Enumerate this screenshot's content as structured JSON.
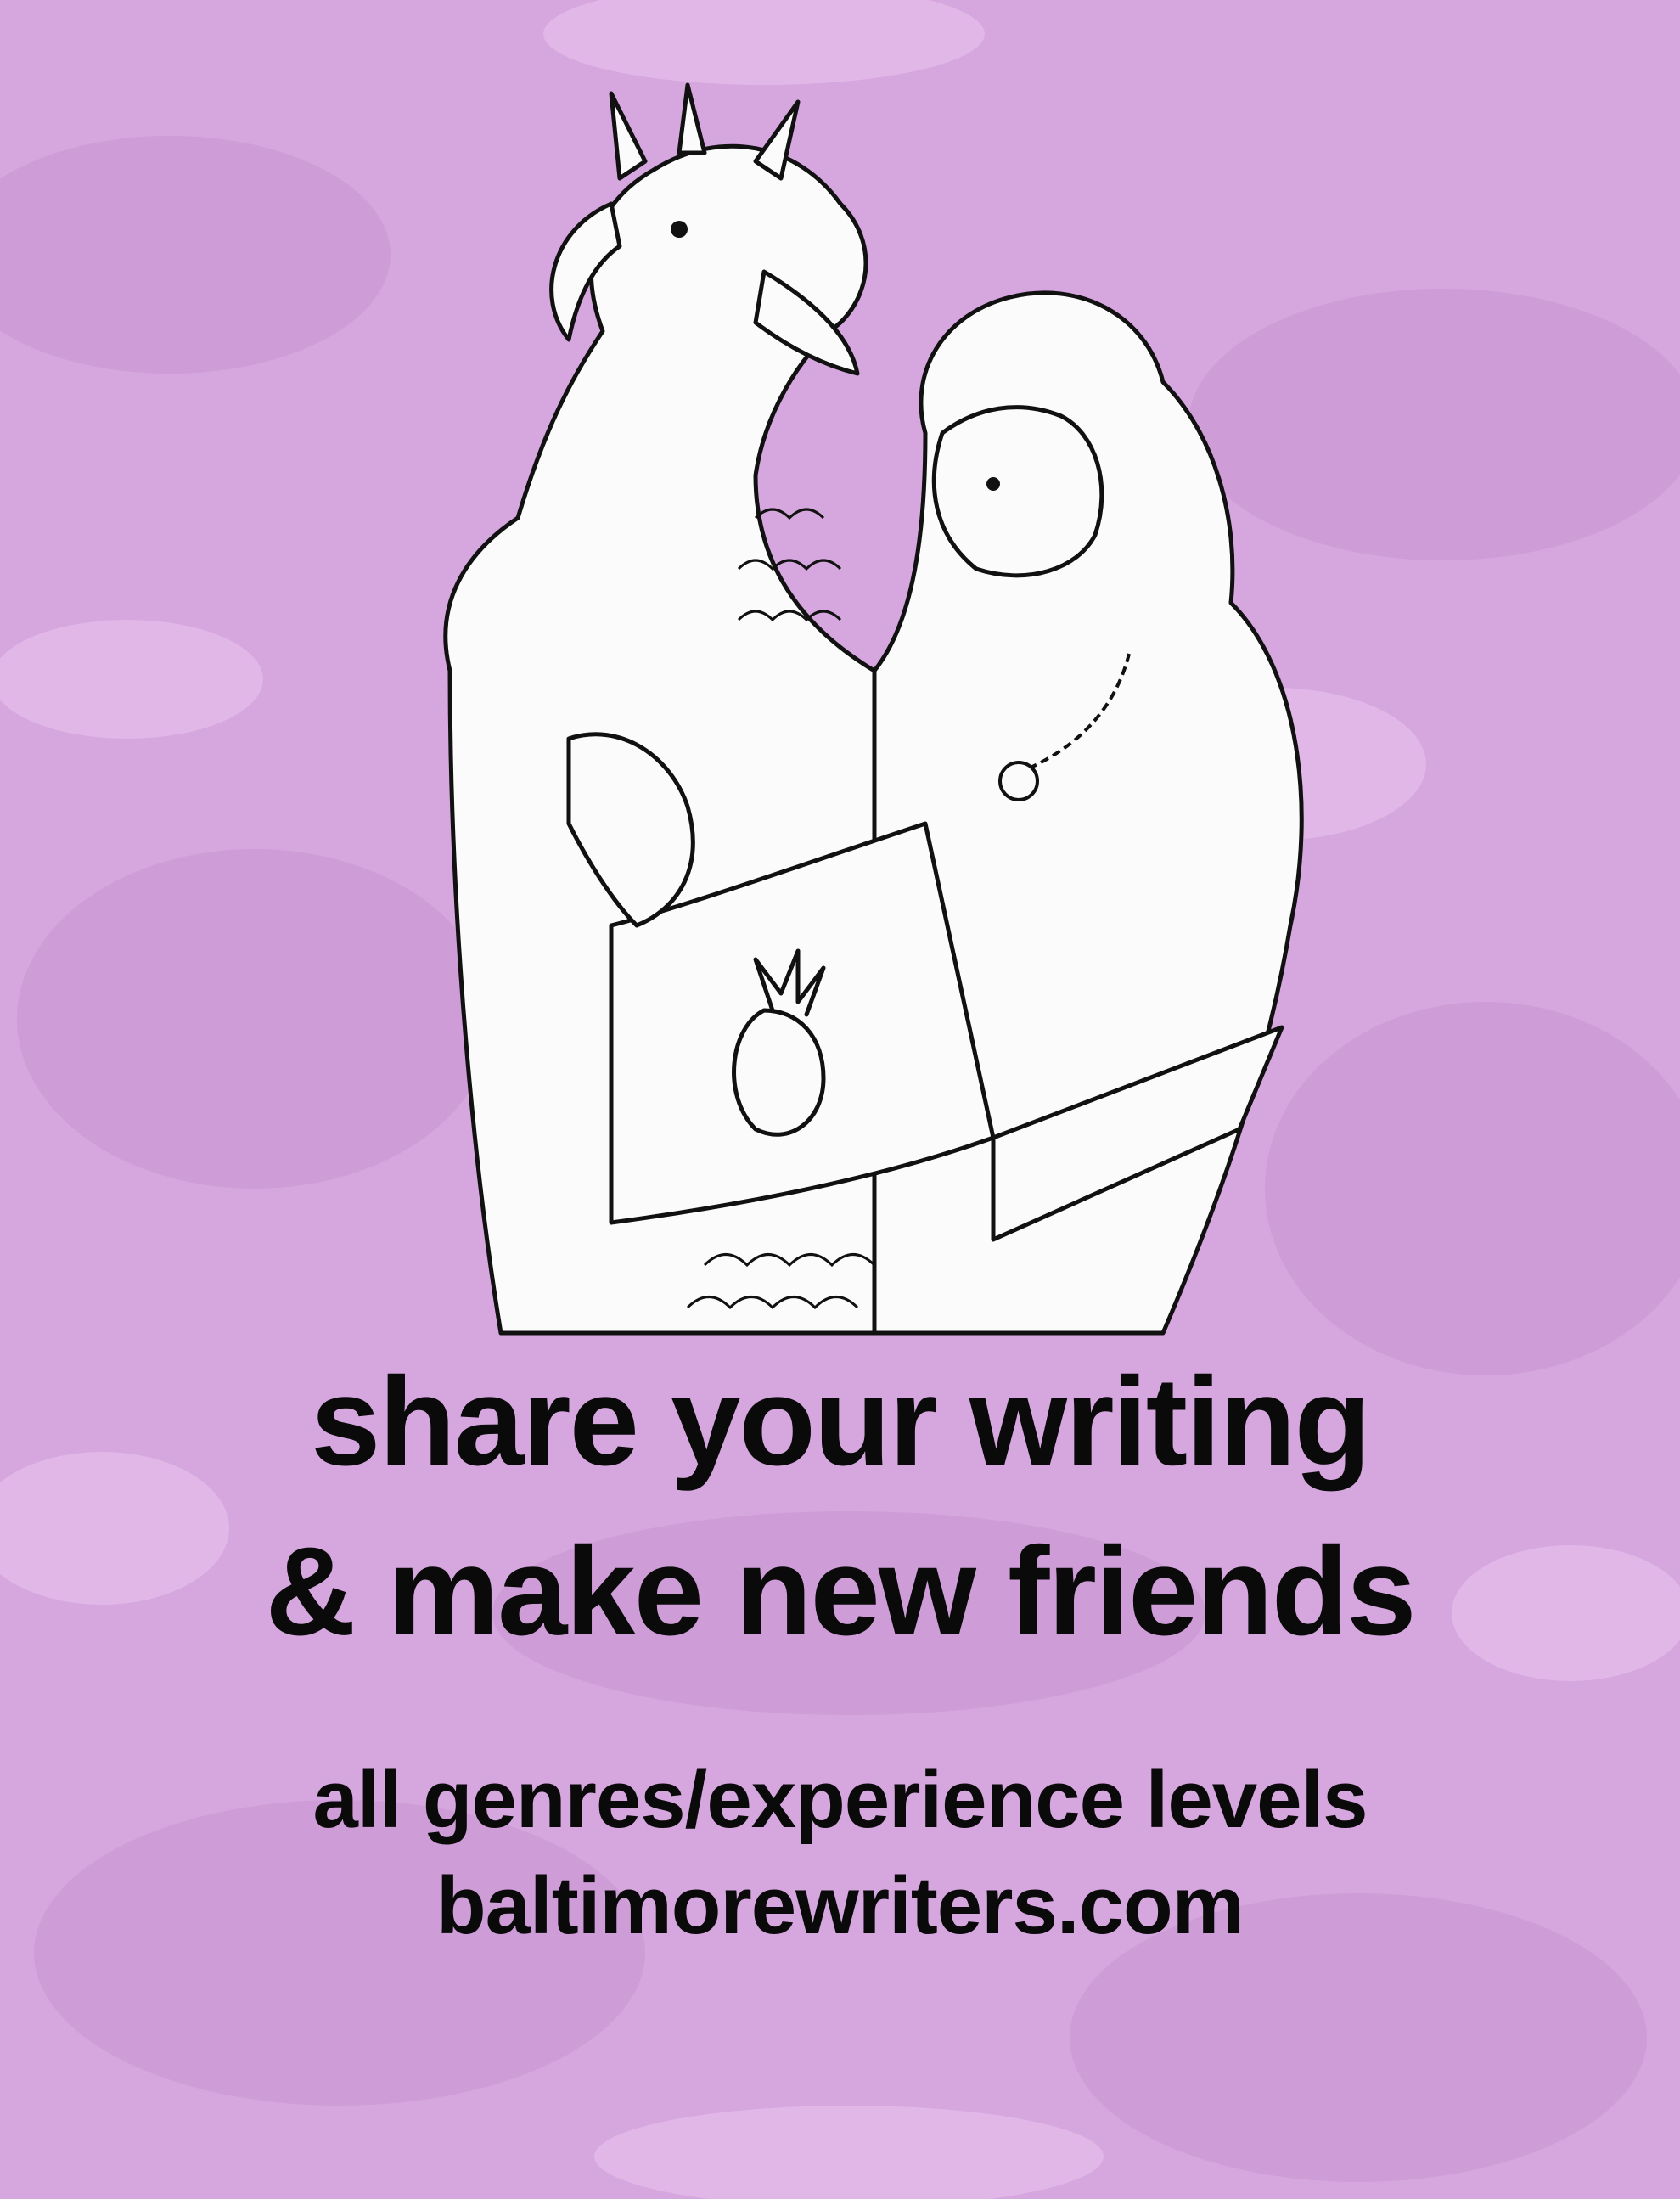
{
  "poster": {
    "background_color": "#d8a8e0",
    "text_color": "#0a0a0a",
    "headline_line1": "share your writing",
    "headline_line2": "& make new friends",
    "subline_1": "all genres/experience levels",
    "subline_2": "baltimorewriters.com",
    "illustration": "dragon-and-lion-with-laptop-drawing"
  }
}
